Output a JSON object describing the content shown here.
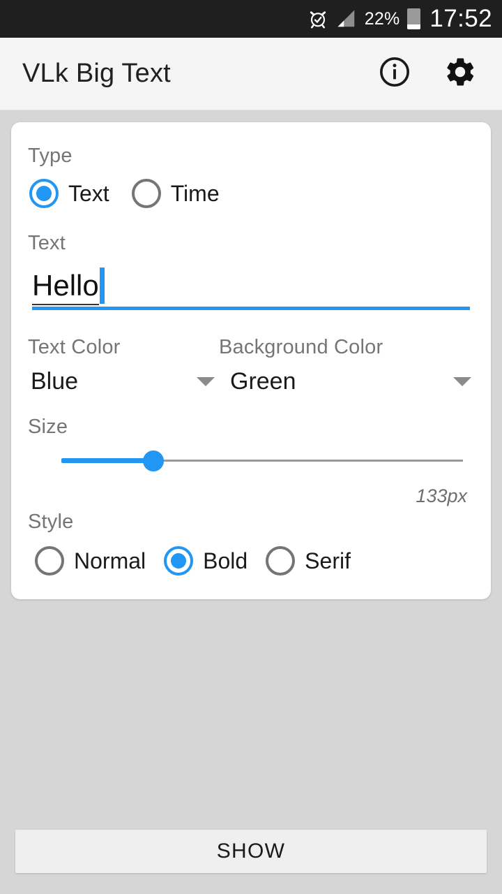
{
  "statusbar": {
    "alarm_icon": "alarm-clock-icon",
    "signal_icon": "signal-bars-icon",
    "battery_percent": "22%",
    "battery_level": 22,
    "battery_icon": "battery-icon",
    "time": "17:52"
  },
  "appbar": {
    "title": "VLk Big Text",
    "info_icon": "info-icon",
    "settings_icon": "gear-icon"
  },
  "form": {
    "type": {
      "label": "Type",
      "options": [
        {
          "label": "Text",
          "selected": true
        },
        {
          "label": "Time",
          "selected": false
        }
      ]
    },
    "text": {
      "label": "Text",
      "value": "Hello"
    },
    "text_color": {
      "label": "Text Color",
      "value": "Blue",
      "arrow_icon": "chevron-down-icon"
    },
    "background_color": {
      "label": "Background Color",
      "value": "Green",
      "arrow_icon": "chevron-down-icon"
    },
    "size": {
      "label": "Size",
      "value_text": "133px",
      "percent": 23
    },
    "style": {
      "label": "Style",
      "options": [
        {
          "label": "Normal",
          "selected": false
        },
        {
          "label": "Bold",
          "selected": true
        },
        {
          "label": "Serif",
          "selected": false
        }
      ]
    }
  },
  "footer": {
    "show_label": "SHOW"
  },
  "colors": {
    "accent": "#2196f3",
    "status_bar": "#1f1f1f",
    "app_bar": "#f5f5f5",
    "page_background": "#d6d6d6",
    "card": "#ffffff",
    "label_gray": "#757575"
  }
}
